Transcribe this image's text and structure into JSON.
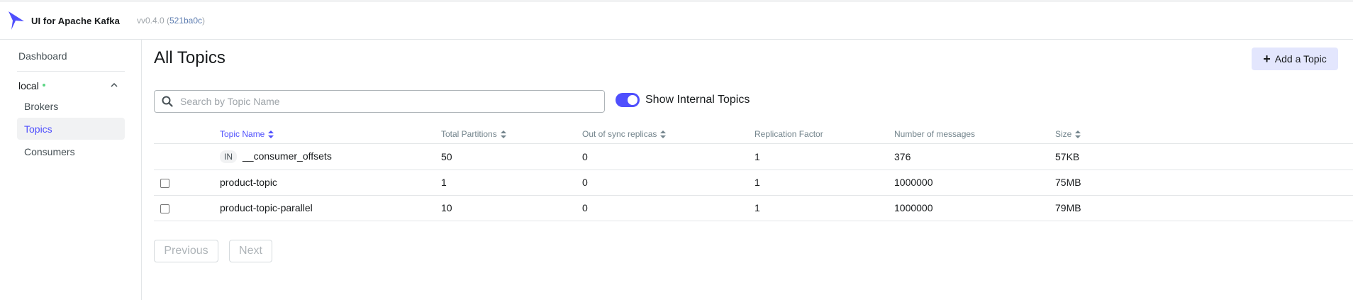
{
  "navbar": {
    "brand": "UI for Apache Kafka",
    "version_prefix": "vv0.4.0 (",
    "commit": "521ba0c",
    "version_suffix": ")"
  },
  "sidebar": {
    "dashboard": "Dashboard",
    "cluster_name": "local",
    "cluster_status_color": "#5cd685",
    "items": [
      {
        "label": "Brokers",
        "active": false
      },
      {
        "label": "Topics",
        "active": true
      },
      {
        "label": "Consumers",
        "active": false
      }
    ]
  },
  "main": {
    "title": "All Topics",
    "add_button": "Add a Topic",
    "search_placeholder": "Search by Topic Name",
    "search_value": "",
    "show_internal_label": "Show Internal Topics",
    "show_internal_on": true
  },
  "table": {
    "headers": {
      "name": "Topic Name",
      "partitions": "Total Partitions",
      "out_of_sync": "Out of sync replicas",
      "replication": "Replication Factor",
      "messages": "Number of messages",
      "size": "Size"
    },
    "rows": [
      {
        "internal_badge": "IN",
        "name": "__consumer_offsets",
        "partitions": "50",
        "out_of_sync": "0",
        "replication": "1",
        "messages": "376",
        "size": "57KB",
        "selectable": false
      },
      {
        "internal_badge": "",
        "name": "product-topic",
        "partitions": "1",
        "out_of_sync": "0",
        "replication": "1",
        "messages": "1000000",
        "size": "75MB",
        "selectable": true
      },
      {
        "internal_badge": "",
        "name": "product-topic-parallel",
        "partitions": "10",
        "out_of_sync": "0",
        "replication": "1",
        "messages": "1000000",
        "size": "79MB",
        "selectable": true
      }
    ]
  },
  "pagination": {
    "previous": "Previous",
    "next": "Next"
  },
  "colors": {
    "accent": "#4f4ffd",
    "add_button_bg": "#e3e6fd"
  }
}
